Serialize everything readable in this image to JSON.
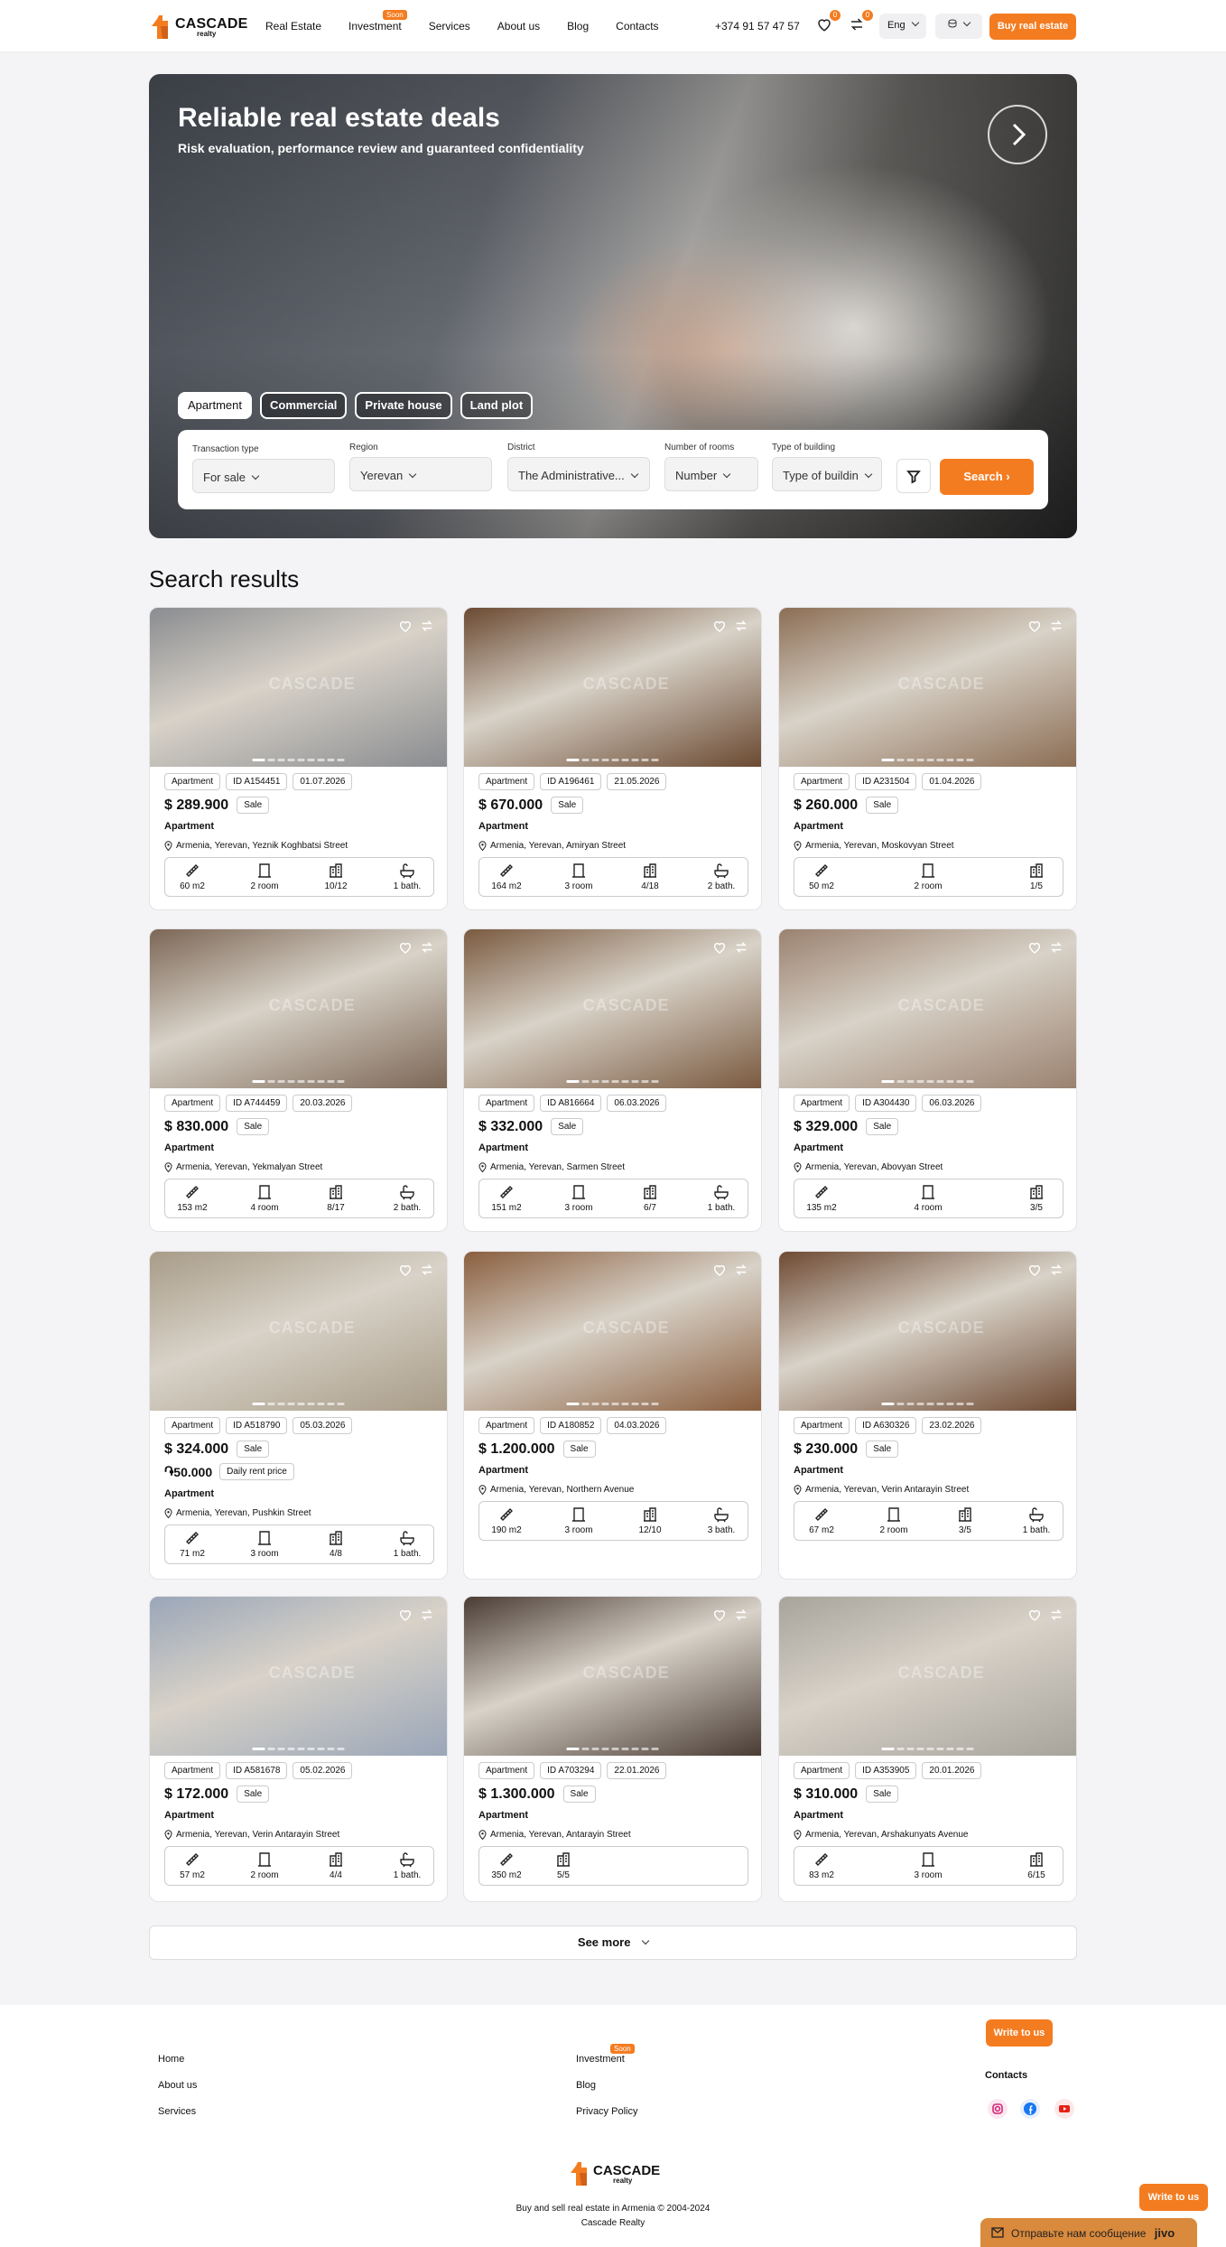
{
  "header": {
    "logo_name": "CASCADE",
    "logo_sub": "realty",
    "nav": [
      "Real Estate",
      "Investment",
      "Services",
      "About us",
      "Blog",
      "Contacts"
    ],
    "soon_badge": "Soon",
    "phone": "+374 91 57 47 57",
    "favorites_count": "0",
    "compare_count": "0",
    "language": "Eng",
    "buy_label": "Buy real estate",
    "accent_color": "#f47c20"
  },
  "hero": {
    "title": "Reliable real estate deals",
    "subtitle": "Risk evaluation, performance review and guaranteed confidentiality",
    "tabs": [
      "Apartment",
      "Commercial",
      "Private house",
      "Land plot"
    ],
    "filters": {
      "transaction_label": "Transaction type",
      "transaction_value": "For sale",
      "region_label": "Region",
      "region_value": "Yerevan",
      "district_label": "District",
      "district_value": "The Administrative...",
      "rooms_label": "Number of rooms",
      "rooms_value": "Number",
      "building_label": "Type of building",
      "building_value": "Type of buildin",
      "search_label": "Search"
    }
  },
  "results_title": "Search results",
  "listings": [
    {
      "type": "Apartment",
      "id": "ID A154451",
      "date": "01.07.2026",
      "price": "$ 289.900",
      "deal": "Sale",
      "address": "Armenia, Yerevan, Yeznik Koghbatsi Street",
      "area": "60 m2",
      "rooms": "2 room",
      "floor": "10/12",
      "bath": "1 bath.",
      "photo": "#8a8c90"
    },
    {
      "type": "Apartment",
      "id": "ID A196461",
      "date": "21.05.2026",
      "price": "$ 670.000",
      "deal": "Sale",
      "address": "Armenia, Yerevan, Amiryan Street",
      "area": "164 m2",
      "rooms": "3 room",
      "floor": "4/18",
      "bath": "2 bath.",
      "photo": "#6b4a32"
    },
    {
      "type": "Apartment",
      "id": "ID A231504",
      "date": "01.04.2026",
      "price": "$ 260.000",
      "deal": "Sale",
      "address": "Armenia, Yerevan, Moskovyan Street",
      "area": "50 m2",
      "rooms": "2 room",
      "floor": "1/5",
      "bath": "",
      "photo": "#8c6e55"
    },
    {
      "type": "Apartment",
      "id": "ID A744459",
      "date": "20.03.2026",
      "price": "$ 830.000",
      "deal": "Sale",
      "address": "Armenia, Yerevan, Yekmalyan Street",
      "area": "153 m2",
      "rooms": "4 room",
      "floor": "8/17",
      "bath": "2 bath.",
      "photo": "#7c6756"
    },
    {
      "type": "Apartment",
      "id": "ID A816664",
      "date": "06.03.2026",
      "price": "$ 332.000",
      "deal": "Sale",
      "address": "Armenia, Yerevan, Sarmen Street",
      "area": "151 m2",
      "rooms": "3 room",
      "floor": "6/7",
      "bath": "1 bath.",
      "photo": "#7a5a40"
    },
    {
      "type": "Apartment",
      "id": "ID A304430",
      "date": "06.03.2026",
      "price": "$ 329.000",
      "deal": "Sale",
      "address": "Armenia, Yerevan, Abovyan Street",
      "area": "135 m2",
      "rooms": "4 room",
      "floor": "3/5",
      "bath": "",
      "photo": "#9b8270"
    },
    {
      "type": "Apartment",
      "id": "ID A518790",
      "date": "05.03.2026",
      "price": "$ 324.000",
      "deal": "Sale",
      "rent": "50.000",
      "rent_label": "Daily rent price",
      "address": "Armenia, Yerevan, Pushkin Street",
      "area": "71 m2",
      "rooms": "3 room",
      "floor": "4/8",
      "bath": "1 bath.",
      "photo": "#a89c88"
    },
    {
      "type": "Apartment",
      "id": "ID A180852",
      "date": "04.03.2026",
      "price": "$ 1.200.000",
      "deal": "Sale",
      "address": "Armenia, Yerevan, Northern Avenue",
      "area": "190 m2",
      "rooms": "3 room",
      "floor": "12/10",
      "bath": "3 bath.",
      "photo": "#8a5e3e"
    },
    {
      "type": "Apartment",
      "id": "ID A630326",
      "date": "23.02.2026",
      "price": "$ 230.000",
      "deal": "Sale",
      "address": "Armenia, Yerevan, Verin Antarayin Street",
      "area": "67 m2",
      "rooms": "2 room",
      "floor": "3/5",
      "bath": "1 bath.",
      "photo": "#6e4a33"
    },
    {
      "type": "Apartment",
      "id": "ID A581678",
      "date": "05.02.2026",
      "price": "$ 172.000",
      "deal": "Sale",
      "address": "Armenia, Yerevan, Verin Antarayin Street",
      "area": "57 m2",
      "rooms": "2 room",
      "floor": "4/4",
      "bath": "1 bath.",
      "photo": "#9aa6b8"
    },
    {
      "type": "Apartment",
      "id": "ID A703294",
      "date": "22.01.2026",
      "price": "$ 1.300.000",
      "deal": "Sale",
      "address": "Armenia, Yerevan, Antarayin Street",
      "area": "350 m2",
      "rooms": "",
      "floor": "5/5",
      "bath": "",
      "photo": "#4a3c34"
    },
    {
      "type": "Apartment",
      "id": "ID A353905",
      "date": "20.01.2026",
      "price": "$ 310.000",
      "deal": "Sale",
      "address": "Armenia, Yerevan, Arshakunyats Avenue",
      "area": "83 m2",
      "rooms": "3 room",
      "floor": "6/15",
      "bath": "",
      "photo": "#a7a49c"
    }
  ],
  "see_more": "See more",
  "footer": {
    "links_left": [
      "Home",
      "About us",
      "Services"
    ],
    "links_mid": [
      "Investment",
      "Blog",
      "Privacy Policy"
    ],
    "write_us": "Write to us",
    "contacts": "Contacts",
    "tagline": "Buy and sell real estate in Armenia © 2004-2024 Cascade Realty",
    "chat_label": "Отправьте нам сообщение",
    "chat_brand": "jivo"
  }
}
